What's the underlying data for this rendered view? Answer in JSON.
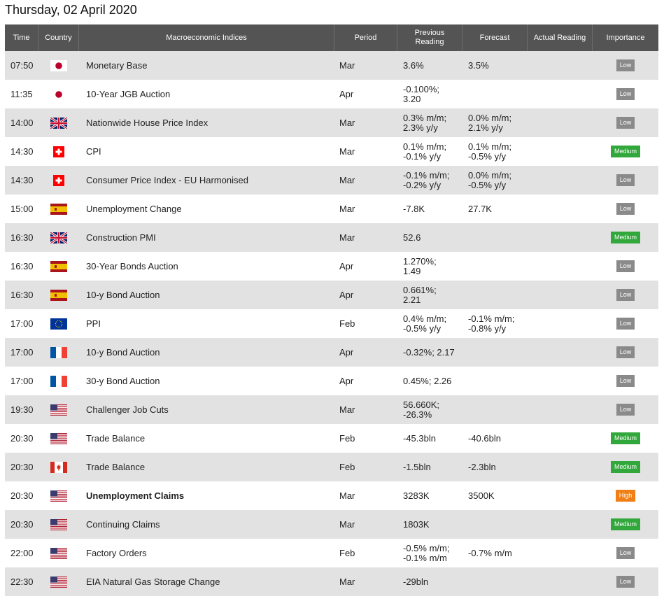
{
  "title": "Thursday, 02 April 2020",
  "headers": {
    "time": "Time",
    "country": "Country",
    "indices": "Macroeconomic Indices",
    "period": "Period",
    "previous": "Previous Reading",
    "forecast": "Forecast",
    "actual": "Actual Reading",
    "importance": "Importance"
  },
  "rows": [
    {
      "time": "07:50",
      "flag": "japan-flag-icon",
      "name": "Monetary Base",
      "period": "Mar",
      "prev1": "3.6%",
      "prev2": "",
      "fc1": "3.5%",
      "fc2": "",
      "actual": "",
      "importance": "Low"
    },
    {
      "time": "11:35",
      "flag": "japan-flag-icon",
      "name": "10-Year JGB Auction",
      "period": "Apr",
      "prev1": "-0.100%;",
      "prev2": "3.20",
      "fc1": "",
      "fc2": "",
      "actual": "",
      "importance": "Low"
    },
    {
      "time": "14:00",
      "flag": "uk-flag-icon",
      "name": "Nationwide House Price Index",
      "period": "Mar",
      "prev1": "0.3% m/m;",
      "prev2": "2.3% y/y",
      "fc1": "0.0% m/m;",
      "fc2": "2.1% y/y",
      "actual": "",
      "importance": "Low"
    },
    {
      "time": "14:30",
      "flag": "switzerland-flag-icon",
      "name": "CPI",
      "period": "Mar",
      "prev1": "0.1% m/m;",
      "prev2": "-0.1% y/y",
      "fc1": "0.1% m/m;",
      "fc2": "-0.5% y/y",
      "actual": "",
      "importance": "Medium"
    },
    {
      "time": "14:30",
      "flag": "switzerland-flag-icon",
      "name": "Consumer Price Index - EU Harmonised",
      "period": "Mar",
      "prev1": "-0.1% m/m;",
      "prev2": "-0.2% y/y",
      "fc1": "0.0% m/m;",
      "fc2": "-0.5% y/y",
      "actual": "",
      "importance": "Low"
    },
    {
      "time": "15:00",
      "flag": "spain-flag-icon",
      "name": "Unemployment Change",
      "period": "Mar",
      "prev1": "-7.8K",
      "prev2": "",
      "fc1": "27.7K",
      "fc2": "",
      "actual": "",
      "importance": "Low"
    },
    {
      "time": "16:30",
      "flag": "uk-flag-icon",
      "name": "Construction PMI",
      "period": "Mar",
      "prev1": "52.6",
      "prev2": "",
      "fc1": "",
      "fc2": "",
      "actual": "",
      "importance": "Medium"
    },
    {
      "time": "16:30",
      "flag": "spain-flag-icon",
      "name": "30-Year Bonds Auction",
      "period": "Apr",
      "prev1": "1.270%;",
      "prev2": "1.49",
      "fc1": "",
      "fc2": "",
      "actual": "",
      "importance": "Low"
    },
    {
      "time": "16:30",
      "flag": "spain-flag-icon",
      "name": "10-y Bond Auction",
      "period": "Apr",
      "prev1": "0.661%;",
      "prev2": "2.21",
      "fc1": "",
      "fc2": "",
      "actual": "",
      "importance": "Low"
    },
    {
      "time": "17:00",
      "flag": "eu-flag-icon",
      "name": "PPI",
      "period": "Feb",
      "prev1": "0.4% m/m;",
      "prev2": "-0.5% y/y",
      "fc1": "-0.1% m/m;",
      "fc2": "-0.8% y/y",
      "actual": "",
      "importance": "Low"
    },
    {
      "time": "17:00",
      "flag": "france-flag-icon",
      "name": "10-y Bond Auction",
      "period": "Apr",
      "prev1": "-0.32%; 2.17",
      "prev2": "",
      "fc1": "",
      "fc2": "",
      "actual": "",
      "importance": "Low"
    },
    {
      "time": "17:00",
      "flag": "france-flag-icon",
      "name": "30-y Bond Auction",
      "period": "Apr",
      "prev1": "0.45%; 2.26",
      "prev2": "",
      "fc1": "",
      "fc2": "",
      "actual": "",
      "importance": "Low"
    },
    {
      "time": "19:30",
      "flag": "usa-flag-icon",
      "name": "Challenger Job Cuts",
      "period": "Mar",
      "prev1": "56.660K;",
      "prev2": "-26.3%",
      "fc1": "",
      "fc2": "",
      "actual": "",
      "importance": "Low"
    },
    {
      "time": "20:30",
      "flag": "usa-flag-icon",
      "name": "Trade Balance",
      "period": "Feb",
      "prev1": "-45.3bln",
      "prev2": "",
      "fc1": "-40.6bln",
      "fc2": "",
      "actual": "",
      "importance": "Medium"
    },
    {
      "time": "20:30",
      "flag": "canada-flag-icon",
      "name": "Trade Balance",
      "period": "Feb",
      "prev1": "-1.5bln",
      "prev2": "",
      "fc1": "-2.3bln",
      "fc2": "",
      "actual": "",
      "importance": "Medium"
    },
    {
      "time": "20:30",
      "flag": "usa-flag-icon",
      "name": "Unemployment Claims",
      "bold": true,
      "period": "Mar",
      "prev1": "3283K",
      "prev2": "",
      "fc1": "3500K",
      "fc2": "",
      "actual": "",
      "importance": "High"
    },
    {
      "time": "20:30",
      "flag": "usa-flag-icon",
      "name": "Continuing Claims",
      "period": "Mar",
      "prev1": "1803K",
      "prev2": "",
      "fc1": "",
      "fc2": "",
      "actual": "",
      "importance": "Medium"
    },
    {
      "time": "22:00",
      "flag": "usa-flag-icon",
      "name": "Factory Orders",
      "period": "Feb",
      "prev1": "-0.5% m/m;",
      "prev2": "-0.1% m/m",
      "fc1": "-0.7% m/m",
      "fc2": "",
      "actual": "",
      "importance": "Low"
    },
    {
      "time": "22:30",
      "flag": "usa-flag-icon",
      "name": "EIA Natural Gas Storage Change",
      "period": "Mar",
      "prev1": "-29bln",
      "prev2": "",
      "fc1": "",
      "fc2": "",
      "actual": "",
      "importance": "Low"
    }
  ],
  "colors": {
    "header_bg": "#545454",
    "row_odd": "#e2e2e2",
    "low": "#8a8a8a",
    "medium": "#32a73b",
    "high": "#f07f16"
  }
}
